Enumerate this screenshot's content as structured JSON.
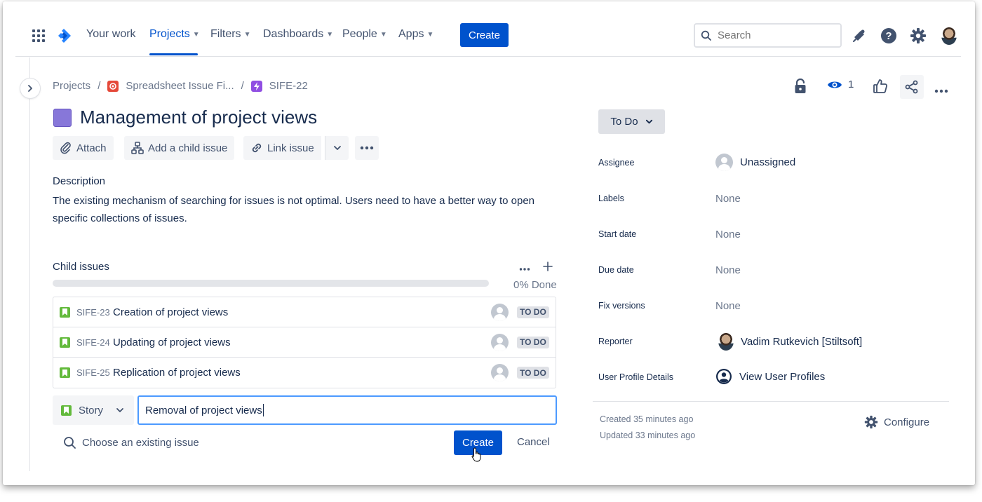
{
  "nav": {
    "items": [
      {
        "label": "Your work",
        "chevron": false,
        "active": false
      },
      {
        "label": "Projects",
        "chevron": true,
        "active": true
      },
      {
        "label": "Filters",
        "chevron": true,
        "active": false
      },
      {
        "label": "Dashboards",
        "chevron": true,
        "active": false
      },
      {
        "label": "People",
        "chevron": true,
        "active": false
      },
      {
        "label": "Apps",
        "chevron": true,
        "active": false
      }
    ],
    "create_label": "Create",
    "search_placeholder": "Search"
  },
  "breadcrumb": {
    "root": "Projects",
    "project": "Spreadsheet Issue Fi...",
    "issue_key": "SIFE-22"
  },
  "issue": {
    "title": "Management of project views",
    "watchers": "1"
  },
  "actions": {
    "attach": "Attach",
    "add_child": "Add a child issue",
    "link_issue": "Link issue"
  },
  "description": {
    "label": "Description",
    "text": "The existing mechanism of searching for issues is not optimal. Users need to have a better way to open specific collections of issues."
  },
  "child_issues": {
    "label": "Child issues",
    "done_fraction": 0,
    "done_text": "0% Done",
    "items": [
      {
        "key": "SIFE-23",
        "summary": "Creation of project views",
        "status": "TO DO"
      },
      {
        "key": "SIFE-24",
        "summary": "Updating of project views",
        "status": "TO DO"
      },
      {
        "key": "SIFE-25",
        "summary": "Replication of project views",
        "status": "TO DO"
      }
    ]
  },
  "new_child": {
    "type": "Story",
    "value": "Removal of project views",
    "choose_existing": "Choose an existing issue",
    "create_label": "Create",
    "cancel_label": "Cancel"
  },
  "sidebar": {
    "status": "To Do",
    "fields": [
      {
        "label": "Assignee",
        "value": "Unassigned",
        "kind": "placeholder-avatar"
      },
      {
        "label": "Labels",
        "value": "None",
        "kind": "empty"
      },
      {
        "label": "Start date",
        "value": "None",
        "kind": "empty"
      },
      {
        "label": "Due date",
        "value": "None",
        "kind": "empty"
      },
      {
        "label": "Fix versions",
        "value": "None",
        "kind": "empty"
      },
      {
        "label": "Reporter",
        "value": "Vadim Rutkevich [Stiltsoft]",
        "kind": "photo-avatar"
      },
      {
        "label": "User Profile Details",
        "value": "View User Profiles",
        "kind": "profile-icon"
      }
    ],
    "created": "Created 35 minutes ago",
    "updated": "Updated 33 minutes ago",
    "configure": "Configure"
  },
  "colors": {
    "brand": "#0052cc",
    "story": "#63ba3c",
    "epic": "#8777d9",
    "focus": "#4c9aff"
  }
}
